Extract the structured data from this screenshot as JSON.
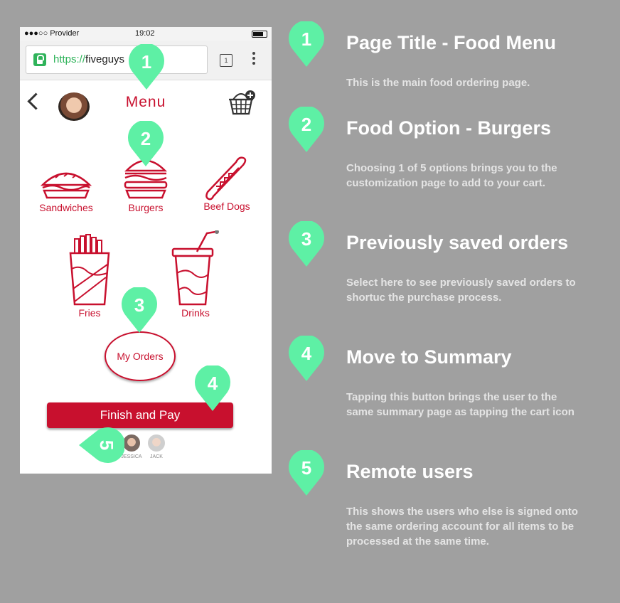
{
  "status": {
    "carrier": "●●●○○ Provider",
    "time": "19:02"
  },
  "browser": {
    "url_scheme": "https://",
    "url_host": "fiveguys",
    "tab_count": "1"
  },
  "header": {
    "title": "Menu"
  },
  "food_options": [
    {
      "label": "Sandwiches",
      "icon": "sandwich-icon"
    },
    {
      "label": "Burgers",
      "icon": "burger-icon"
    },
    {
      "label": "Beef Dogs",
      "icon": "hotdog-icon"
    },
    {
      "label": "Fries",
      "icon": "fries-icon"
    },
    {
      "label": "Drinks",
      "icon": "drink-icon"
    }
  ],
  "my_orders_label": "My Orders",
  "finish_button_label": "Finish and Pay",
  "remote_users": [
    {
      "name": "JESSICA"
    },
    {
      "name": "JACK"
    }
  ],
  "pins": [
    "1",
    "2",
    "3",
    "4",
    "5"
  ],
  "annotations": [
    {
      "number": "1",
      "title": "Page Title - Food Menu",
      "description": "This is the main food ordering page."
    },
    {
      "number": "2",
      "title": "Food Option - Burgers",
      "description": "Choosing 1 of 5 options brings you to the customization page to add to your cart."
    },
    {
      "number": "3",
      "title": "Previously saved orders",
      "description": "Select here to see previously saved orders to shortuc the purchase process."
    },
    {
      "number": "4",
      "title": "Move to Summary",
      "description": "Tapping this button brings the user to the same summary page as tapping the cart icon"
    },
    {
      "number": "5",
      "title": "Remote users",
      "description": "This shows the users who else is signed onto the same ordering account for all items to be processed at the same time."
    }
  ],
  "colors": {
    "brand_red": "#c8102e",
    "pin_green": "#5ef0a5",
    "background": "#a0a0a0"
  }
}
